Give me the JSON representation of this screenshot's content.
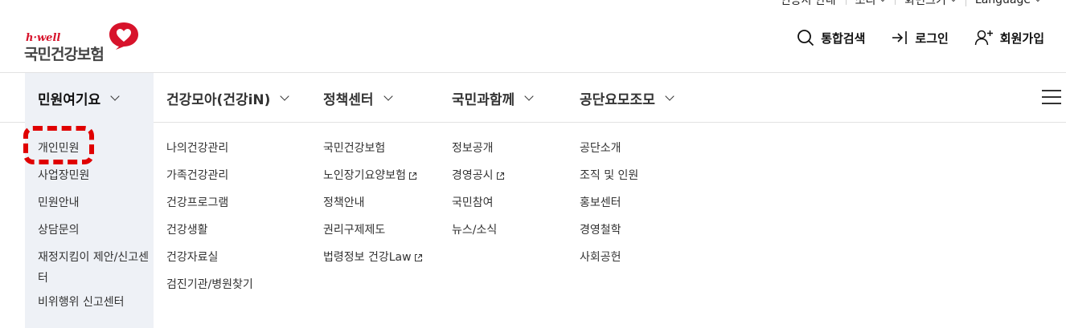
{
  "utility": {
    "items": [
      {
        "label": "인증서 안내",
        "dropdown": false
      },
      {
        "label": "소리",
        "dropdown": true
      },
      {
        "label": "화면크기",
        "dropdown": true
      },
      {
        "label": "Language",
        "dropdown": true
      }
    ]
  },
  "logo": {
    "tagline": "h·well",
    "name": "국민건강보험",
    "brand_color": "#d7132b"
  },
  "header_actions": {
    "search": "통합검색",
    "login": "로그인",
    "signup": "회원가입"
  },
  "gnb": {
    "tabs": [
      {
        "label": "민원여기요",
        "active": true
      },
      {
        "label": "건강모아(건강iN)",
        "active": false
      },
      {
        "label": "정책센터",
        "active": false
      },
      {
        "label": "국민과함께",
        "active": false
      },
      {
        "label": "공단요모조모",
        "active": false
      }
    ],
    "active_bg": "#eef1f6"
  },
  "submenu": {
    "col1": [
      "개인민원",
      "사업장민원",
      "민원안내",
      "상담문의",
      "재정지킴이 제안/신고센터",
      "비위행위 신고센터"
    ],
    "col2": [
      "나의건강관리",
      "가족건강관리",
      "건강프로그램",
      "건강생활",
      "건강자료실",
      "검진기관/병원찾기"
    ],
    "col3": [
      {
        "label": "국민건강보험",
        "external": false
      },
      {
        "label": "노인장기요양보험",
        "external": true
      },
      {
        "label": "정책안내",
        "external": false
      },
      {
        "label": "권리구제제도",
        "external": false
      },
      {
        "label": "법령정보 건강Law",
        "external": true
      }
    ],
    "col4": [
      {
        "label": "정보공개",
        "external": false
      },
      {
        "label": "경영공시",
        "external": true
      },
      {
        "label": "국민참여",
        "external": false
      },
      {
        "label": "뉴스/소식",
        "external": false
      }
    ],
    "col5": [
      "공단소개",
      "조직 및 인원",
      "홍보센터",
      "경영철학",
      "사회공헌"
    ]
  },
  "highlight_color": "#e00000"
}
